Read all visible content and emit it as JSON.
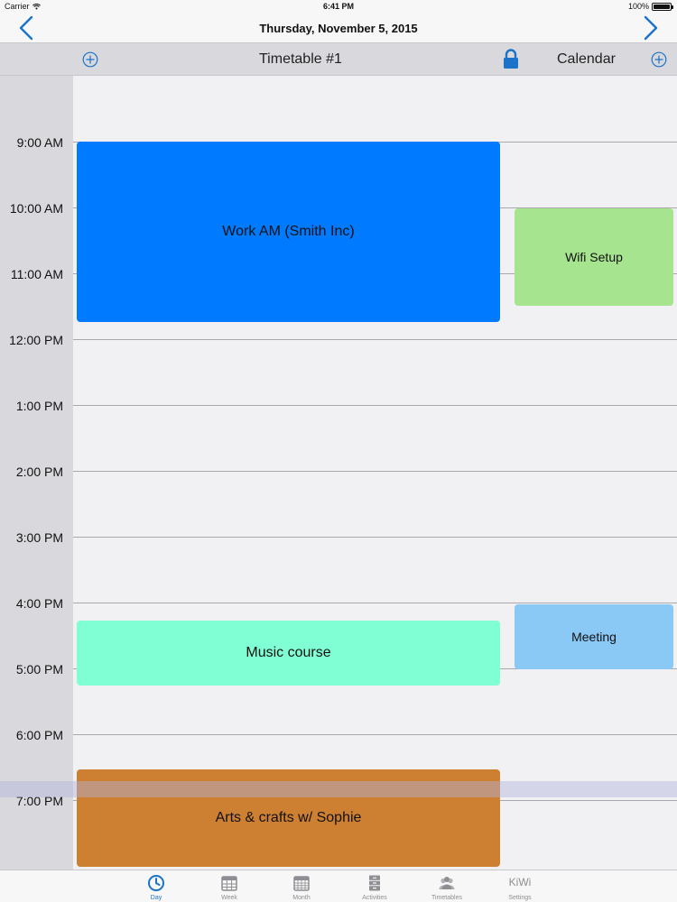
{
  "status_bar": {
    "carrier": "Carrier",
    "time": "6:41 PM",
    "battery": "100%"
  },
  "nav": {
    "title": "Thursday, November 5, 2015",
    "prev_icon": "chevron-left-icon",
    "next_icon": "chevron-right-icon"
  },
  "columns": {
    "timetable_label": "Timetable #1",
    "calendar_label": "Calendar"
  },
  "time_labels": [
    "9:00 AM",
    "10:00 AM",
    "11:00 AM",
    "12:00 PM",
    "1:00 PM",
    "2:00 PM",
    "3:00 PM",
    "4:00 PM",
    "5:00 PM",
    "6:00 PM",
    "7:00 PM"
  ],
  "events": {
    "work": {
      "title": "Work AM (Smith Inc)",
      "color": "#007aff"
    },
    "wifi": {
      "title": "Wifi Setup",
      "color": "#a6e48f"
    },
    "music": {
      "title": "Music course",
      "color": "#80ffd4"
    },
    "meeting": {
      "title": "Meeting",
      "color": "#8ac9f5"
    },
    "arts": {
      "title": "Arts & crafts w/ Sophie",
      "color": "#cd7f32"
    }
  },
  "tabs": [
    {
      "label": "Day",
      "icon": "clock-icon",
      "active": true
    },
    {
      "label": "Week",
      "icon": "week-calendar-icon",
      "active": false
    },
    {
      "label": "Month",
      "icon": "month-calendar-icon",
      "active": false
    },
    {
      "label": "Activities",
      "icon": "cabinet-icon",
      "active": false
    },
    {
      "label": "Timetables",
      "icon": "people-icon",
      "active": false
    },
    {
      "label": "Settings",
      "icon_text": "KiWi",
      "active": false
    }
  ],
  "accent": "#1a73c9"
}
